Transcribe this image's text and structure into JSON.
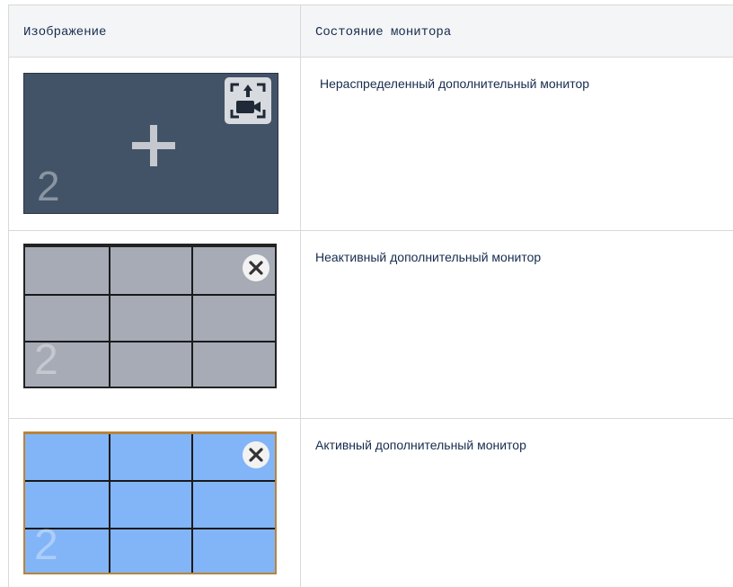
{
  "table": {
    "headers": [
      "Изображение",
      "Состояние монитора"
    ],
    "rows": [
      {
        "monitor_number": "2",
        "state_text": "Нераспределенный дополнительный монитор",
        "icons": [
          "plus-icon",
          "assign-camera-icon"
        ]
      },
      {
        "monitor_number": "2",
        "state_text": "Неактивный дополнительный монитор",
        "icons": [
          "close-icon"
        ]
      },
      {
        "monitor_number": "2",
        "state_text": "Активный дополнительный монитор",
        "icons": [
          "close-icon"
        ]
      }
    ]
  },
  "colors": {
    "unassigned_bg": "#425368",
    "inactive_bg": "#a6abb6",
    "active_bg": "#82b4f8",
    "active_border": "#b8843a"
  }
}
